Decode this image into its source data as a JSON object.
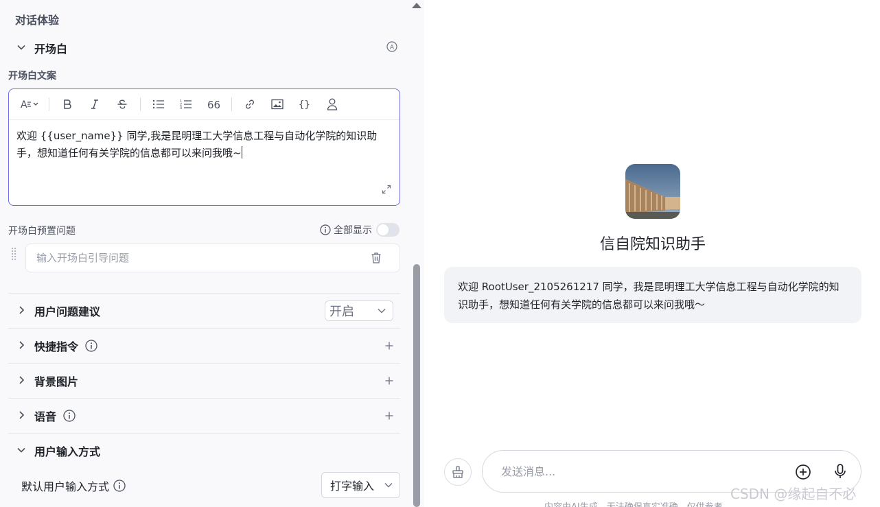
{
  "left": {
    "section_title": "对话体验",
    "opening": {
      "title": "开场白",
      "badge": "A",
      "copy_label": "开场白文案",
      "editor_text": "欢迎 {{user_name}} 同学,我是昆明理工大学信息工程与自动化学院的知识助手，想知道任何有关学院的信息都可以来问我哦~",
      "toolbar": [
        "font-size-icon",
        "bold-icon",
        "italic-icon",
        "strikethrough-icon",
        "bullet-list-icon",
        "ordered-list-icon",
        "quote-icon",
        "link-icon",
        "image-icon",
        "variable-icon",
        "user-icon"
      ],
      "preset_label": "开场白预置问题",
      "show_all_label": "全部显示",
      "show_all_on": false,
      "question_placeholder": "输入开场白引导问题"
    },
    "rows": [
      {
        "label": "用户问题建议",
        "select_value": "开启"
      },
      {
        "label": "快捷指令",
        "has_info": true
      },
      {
        "label": "背景图片"
      },
      {
        "label": "语音",
        "has_info": true
      },
      {
        "label": "用户输入方式"
      }
    ],
    "input_mode": {
      "label": "默认用户输入方式",
      "value": "打字输入"
    }
  },
  "right": {
    "bot_name": "信自院知识助手",
    "greeting": "欢迎 RootUser_2105261217 同学，我是昆明理工大学信息工程与自动化学院的知识助手，想知道任何有关学院的信息都可以来问我哦～",
    "input_placeholder": "发送消息...",
    "disclaimer": "内容由AI生成，无法确保真实准确，仅供参考"
  },
  "watermark": "CSDN @缘起自不必",
  "colors": {
    "accent": "#6b6ce0",
    "panel_bg": "#f9f9fb",
    "bubble_bg": "#f2f3f7"
  }
}
